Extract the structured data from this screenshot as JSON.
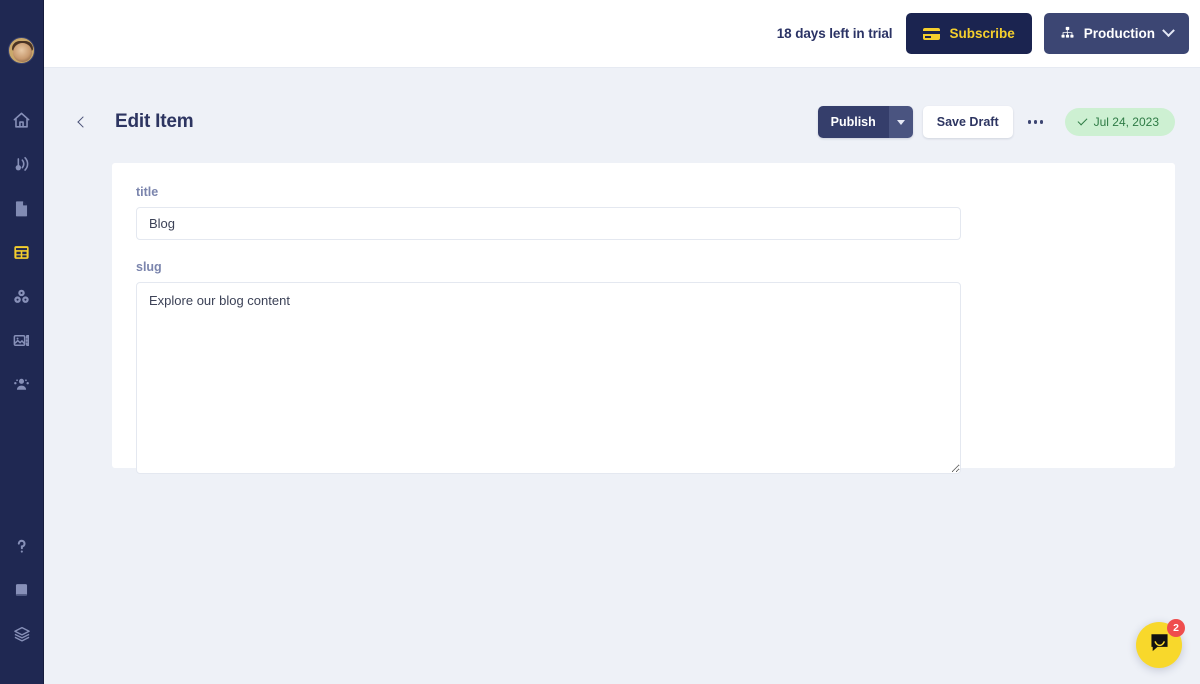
{
  "sidebar": {
    "avatar_name": "user-avatar",
    "top_items": [
      {
        "name": "home-icon",
        "label": "Home"
      },
      {
        "name": "megaphone-icon",
        "label": "Broadcasts"
      },
      {
        "name": "document-icon",
        "label": "Documents"
      },
      {
        "name": "table-grid-icon",
        "label": "Collections",
        "active": true
      },
      {
        "name": "blocks-icon",
        "label": "Components"
      },
      {
        "name": "media-images-icon",
        "label": "Media"
      },
      {
        "name": "users-icon",
        "label": "Users"
      }
    ],
    "bottom_items": [
      {
        "name": "help-question-icon",
        "label": "Help"
      },
      {
        "name": "book-icon",
        "label": "Docs"
      },
      {
        "name": "layers-stack-icon",
        "label": "Layers"
      }
    ]
  },
  "topbar": {
    "trial_text": "18 days left in trial",
    "subscribe_label": "Subscribe",
    "subscribe_icon": "credit-card-icon",
    "environment_label": "Production",
    "environment_icon": "sitemap-icon",
    "environment_caret": "chevron-down-icon",
    "subscribe_bg": "#1b2450",
    "subscribe_fg": "#f5cf2d",
    "environment_bg": "#3c4673"
  },
  "page": {
    "back_icon": "chevron-left-icon",
    "title": "Edit Item",
    "publish_label": "Publish",
    "publish_caret_icon": "caret-down-icon",
    "save_draft_label": "Save Draft",
    "more_icon": "ellipsis-icon",
    "status_badge": {
      "icon": "check-icon",
      "text": "Jul 24, 2023",
      "bg": "#cdf0d2",
      "fg": "#2e7b45"
    }
  },
  "form": {
    "fields": [
      {
        "name": "title",
        "label": "title",
        "type": "input",
        "value": "Blog",
        "placeholder": ""
      },
      {
        "name": "slug",
        "label": "slug",
        "type": "textarea",
        "value": "Explore our blog content",
        "placeholder": ""
      }
    ]
  },
  "intercom": {
    "icon": "chat-bubble-icon",
    "badge_count": "2",
    "bg": "#f8d82b",
    "badge_bg": "#ef4d4d"
  }
}
